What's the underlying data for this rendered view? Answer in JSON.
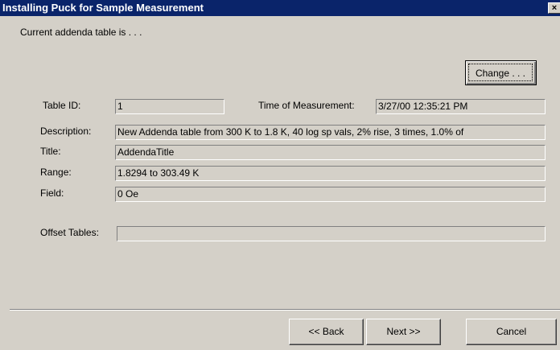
{
  "window": {
    "title": "Installing Puck for Sample Measurement",
    "close_glyph": "×"
  },
  "header": {
    "intro": "Current addenda table is . . ."
  },
  "buttons": {
    "change": "Change . . .",
    "back": "<< Back",
    "next": "Next >>",
    "cancel": "Cancel"
  },
  "fields": {
    "table_id_label": "Table ID:",
    "table_id_value": "1",
    "time_label": "Time of Measurement:",
    "time_value": "3/27/00 12:35:21 PM",
    "description_label": "Description:",
    "description_value": "New Addenda table from 300 K to 1.8 K, 40 log sp vals, 2% rise, 3 times, 1.0% of",
    "title_label": "Title:",
    "title_value": "AddendaTitle",
    "range_label": "Range:",
    "range_value": "1.8294 to 303.49 K",
    "field_label": "Field:",
    "field_value": "0 Oe",
    "offset_label": "Offset Tables:",
    "offset_value": ""
  }
}
